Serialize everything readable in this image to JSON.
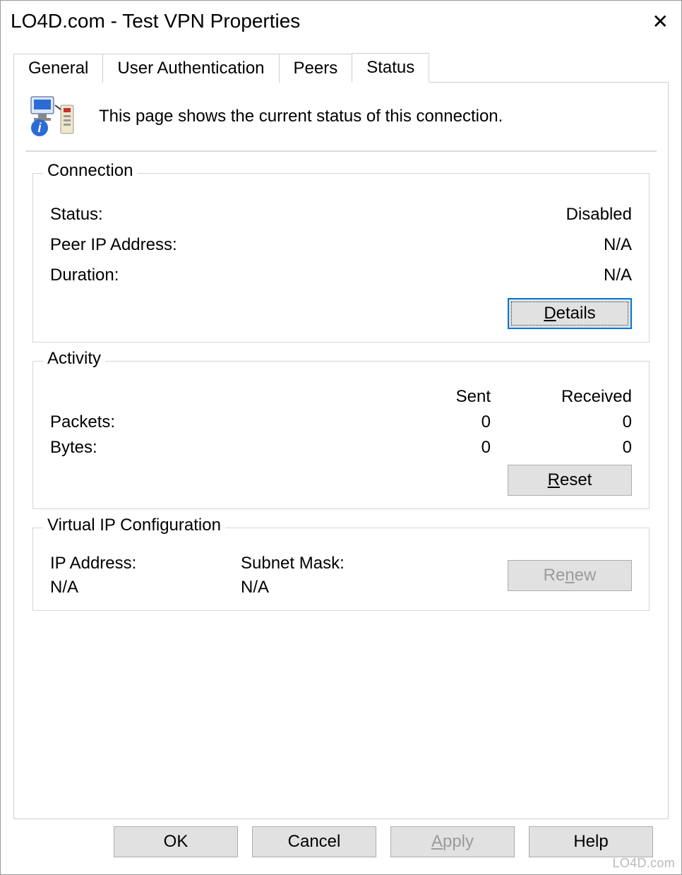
{
  "window": {
    "title": "LO4D.com  - Test VPN Properties"
  },
  "tabs": {
    "general": "General",
    "user_auth": "User Authentication",
    "peers": "Peers",
    "status": "Status",
    "active": "status"
  },
  "status_page": {
    "description": "This page shows the current status of this connection.",
    "connection": {
      "legend": "Connection",
      "status_label": "Status:",
      "status_value": "Disabled",
      "peer_ip_label": "Peer IP Address:",
      "peer_ip_value": "N/A",
      "duration_label": "Duration:",
      "duration_value": "N/A",
      "details_btn": "Details"
    },
    "activity": {
      "legend": "Activity",
      "sent_header": "Sent",
      "received_header": "Received",
      "packets_label": "Packets:",
      "packets_sent": "0",
      "packets_received": "0",
      "bytes_label": "Bytes:",
      "bytes_sent": "0",
      "bytes_received": "0",
      "reset_btn": "Reset"
    },
    "ipcfg": {
      "legend": "Virtual IP Configuration",
      "ip_label": "IP Address:",
      "ip_value": "N/A",
      "mask_label": "Subnet Mask:",
      "mask_value": "N/A",
      "renew_btn": "Renew"
    }
  },
  "dialog_buttons": {
    "ok": "OK",
    "cancel": "Cancel",
    "apply": "Apply",
    "help": "Help"
  },
  "watermark": "LO4D.com"
}
